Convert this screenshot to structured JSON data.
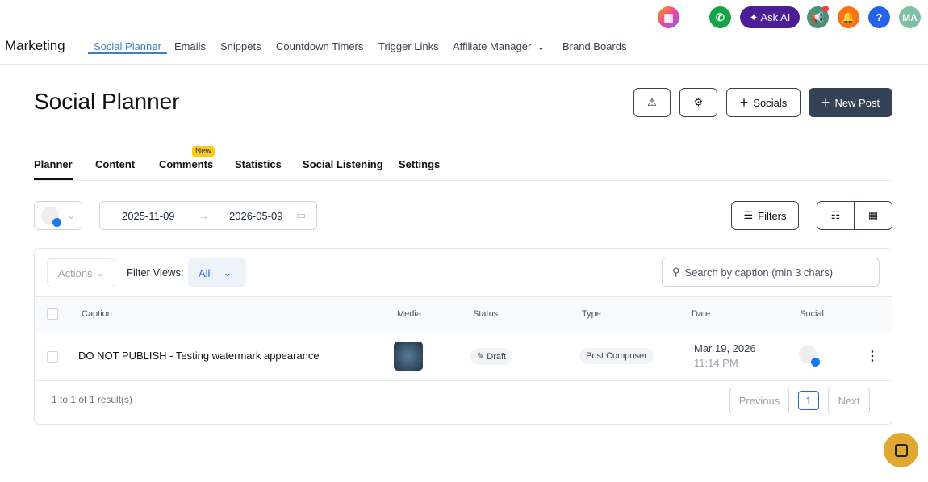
{
  "topbar": {
    "ask_ai": "✦ Ask AI",
    "avatar": "MA",
    "help": "?"
  },
  "nav": {
    "brand": "Marketing",
    "items": [
      "Social Planner",
      "Emails",
      "Snippets",
      "Countdown Timers",
      "Trigger Links",
      "Affiliate Manager",
      "Brand Boards"
    ]
  },
  "page": {
    "title": "Social Planner",
    "socials_label": "Socials",
    "new_post_label": "New Post"
  },
  "tabs": [
    "Planner",
    "Content",
    "Comments",
    "Statistics",
    "Social Listening",
    "Settings"
  ],
  "new_badge": "New",
  "dates": {
    "start": "2025-11-09",
    "end": "2026-05-09"
  },
  "filters_label": "Filters",
  "toolbar": {
    "actions": "Actions",
    "filter_views": "Filter Views:",
    "view_value": "All",
    "search_placeholder": "Search by caption (min 3 chars)"
  },
  "columns": [
    "Caption",
    "Media",
    "Status",
    "Type",
    "Date",
    "Social"
  ],
  "rows": [
    {
      "caption": "DO NOT PUBLISH - Testing watermark appearance",
      "status": "Draft",
      "type": "Post Composer",
      "date": "Mar 19, 2026",
      "time": "11:14 PM"
    }
  ],
  "pagination": {
    "summary": "1 to 1 of 1 result(s)",
    "previous": "Previous",
    "page": "1",
    "next": "Next"
  }
}
